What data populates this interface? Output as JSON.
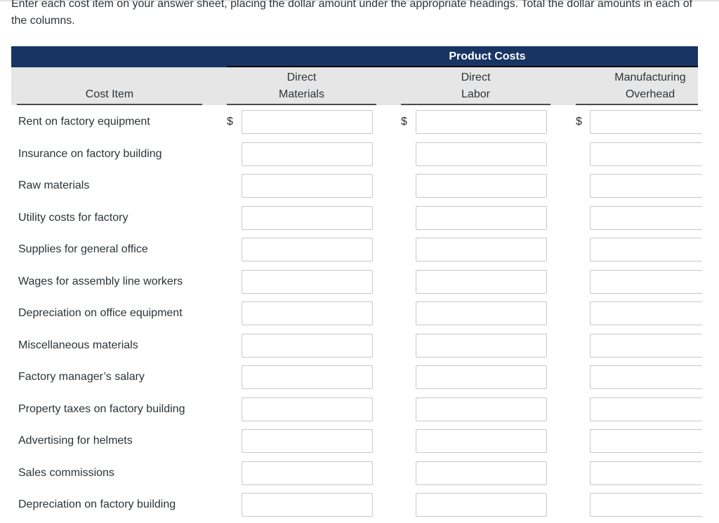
{
  "instructions": "Enter each cost item on your answer sheet, placing the dollar amount under the appropriate headings. Total the dollar amounts in each of the columns.",
  "table": {
    "group_header": "Product Costs",
    "columns": {
      "cost_item": "Cost Item",
      "direct_materials": [
        "Direct",
        "Materials"
      ],
      "direct_labor": [
        "Direct",
        "Labor"
      ],
      "manufacturing_overhead": [
        "Manufacturing",
        "Overhead"
      ]
    },
    "currency_symbol": "$",
    "rows": [
      {
        "label": "Rent on factory equipment",
        "dm": "",
        "dl": "",
        "moh": ""
      },
      {
        "label": "Insurance on factory building",
        "dm": "",
        "dl": "",
        "moh": ""
      },
      {
        "label": "Raw materials",
        "dm": "",
        "dl": "",
        "moh": ""
      },
      {
        "label": "Utility costs for factory",
        "dm": "",
        "dl": "",
        "moh": ""
      },
      {
        "label": "Supplies for general office",
        "dm": "",
        "dl": "",
        "moh": ""
      },
      {
        "label": "Wages for assembly line workers",
        "dm": "",
        "dl": "",
        "moh": ""
      },
      {
        "label": "Depreciation on office equipment",
        "dm": "",
        "dl": "",
        "moh": ""
      },
      {
        "label": "Miscellaneous materials",
        "dm": "",
        "dl": "",
        "moh": ""
      },
      {
        "label": "Factory manager’s salary",
        "dm": "",
        "dl": "",
        "moh": ""
      },
      {
        "label": "Property taxes on factory building",
        "dm": "",
        "dl": "",
        "moh": ""
      },
      {
        "label": "Advertising for helmets",
        "dm": "",
        "dl": "",
        "moh": ""
      },
      {
        "label": "Sales commissions",
        "dm": "",
        "dl": "",
        "moh": ""
      },
      {
        "label": "Depreciation on factory building",
        "dm": "",
        "dl": "",
        "moh": ""
      }
    ]
  },
  "colors": {
    "header_bar": "#173463",
    "subheader_bg": "#e6e6e6",
    "text": "#2d3338"
  }
}
